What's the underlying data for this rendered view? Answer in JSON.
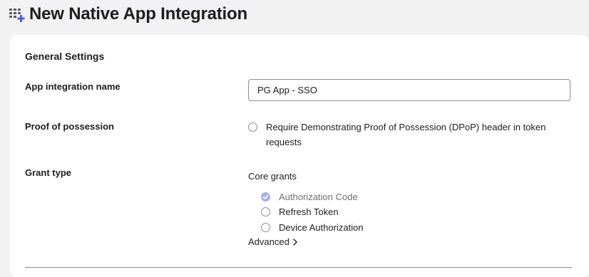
{
  "header": {
    "title": "New Native App Integration",
    "icon": "app-grid-add-icon"
  },
  "general_settings": {
    "title": "General Settings",
    "app_name": {
      "label": "App integration name",
      "value": "PG App - SSO"
    },
    "proof_of_possession": {
      "label": "Proof of possession",
      "checkbox_label": "Require Demonstrating Proof of Possession (DPoP) header in token requests",
      "checked": false
    },
    "grant_type": {
      "label": "Grant type",
      "core_grants_label": "Core grants",
      "grants": [
        {
          "label": "Authorization Code",
          "checked": true,
          "disabled": true
        },
        {
          "label": "Refresh Token",
          "checked": false,
          "disabled": false
        },
        {
          "label": "Device Authorization",
          "checked": false,
          "disabled": false
        }
      ],
      "advanced_label": "Advanced"
    }
  },
  "colors": {
    "accent": "#a7b1e8",
    "icon_blue": "#4a5fe0",
    "text": "#1d1d21"
  }
}
